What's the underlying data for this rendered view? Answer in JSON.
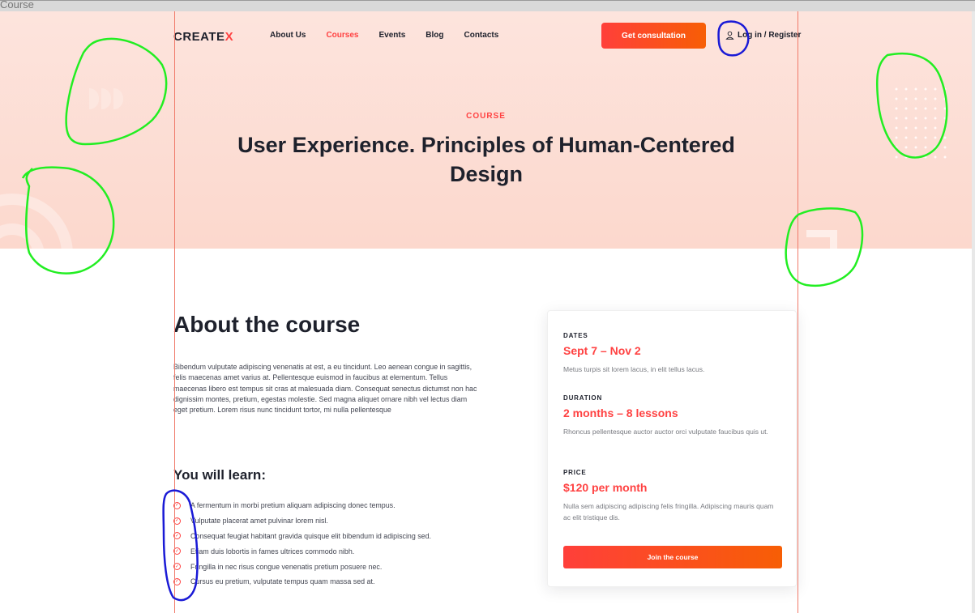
{
  "browser": {
    "tab_title": "Course"
  },
  "header": {
    "logo": "CREATE",
    "logo_mark": "X",
    "nav": [
      "About Us",
      "Courses",
      "Events",
      "Blog",
      "Contacts"
    ],
    "active_nav": "Courses",
    "cta": "Get consultation",
    "login": "Log in / Register",
    "login_icon": "user-icon"
  },
  "hero": {
    "eyebrow": "COURSE",
    "title": "User Experience. Principles of Human-Centered Design"
  },
  "about": {
    "title": "About the course",
    "text": "Bibendum vulputate adipiscing venenatis at est, a eu tincidunt. Leo aenean congue in sagittis, felis maecenas amet varius at. Pellentesque euismod in faucibus at elementum. Tellus maecenas libero est tempus sit cras at malesuada diam. Consequat senectus dictumst non hac dignissim montes, pretium, egestas molestie. Sed magna aliquet ornare nibh vel lectus diam eget pretium. Lorem risus nunc tincidunt tortor, mi nulla pellentesque"
  },
  "learn": {
    "title": "You will learn:",
    "items": [
      "A fermentum in morbi pretium aliquam adipiscing donec tempus.",
      "Vulputate placerat amet pulvinar lorem nisl.",
      "Consequat feugiat habitant gravida quisque elit bibendum id adipiscing sed.",
      "Etiam duis lobortis in fames ultrices commodo nibh.",
      "Fringilla in nec risus congue venenatis pretium posuere nec.",
      "Cursus eu pretium, vulputate tempus quam massa sed at."
    ]
  },
  "card": {
    "dates_label": "DATES",
    "dates_value": "Sept 7 – Nov 2",
    "dates_desc": "Metus turpis sit lorem lacus, in elit tellus lacus.",
    "duration_label": "DURATION",
    "duration_value": "2 months – 8 lessons",
    "duration_desc": "Rhoncus pellentesque auctor auctor orci vulputate faucibus quis ut.",
    "price_label": "PRICE",
    "price_value": "$120 per month",
    "price_desc": "Nulla sem adipiscing adipiscing felis fringilla. Adipiscing mauris quam ac elit tristique dis.",
    "join": "Join the course"
  },
  "colors": {
    "accent": "#ff4242",
    "accent_gradient_end": "#f75e05",
    "hero_bg": "#fcd8cd",
    "heading": "#1e212c",
    "guide_line": "#f07a6a",
    "annotation_green": "#22ee22",
    "annotation_blue": "#1a1ad6"
  }
}
